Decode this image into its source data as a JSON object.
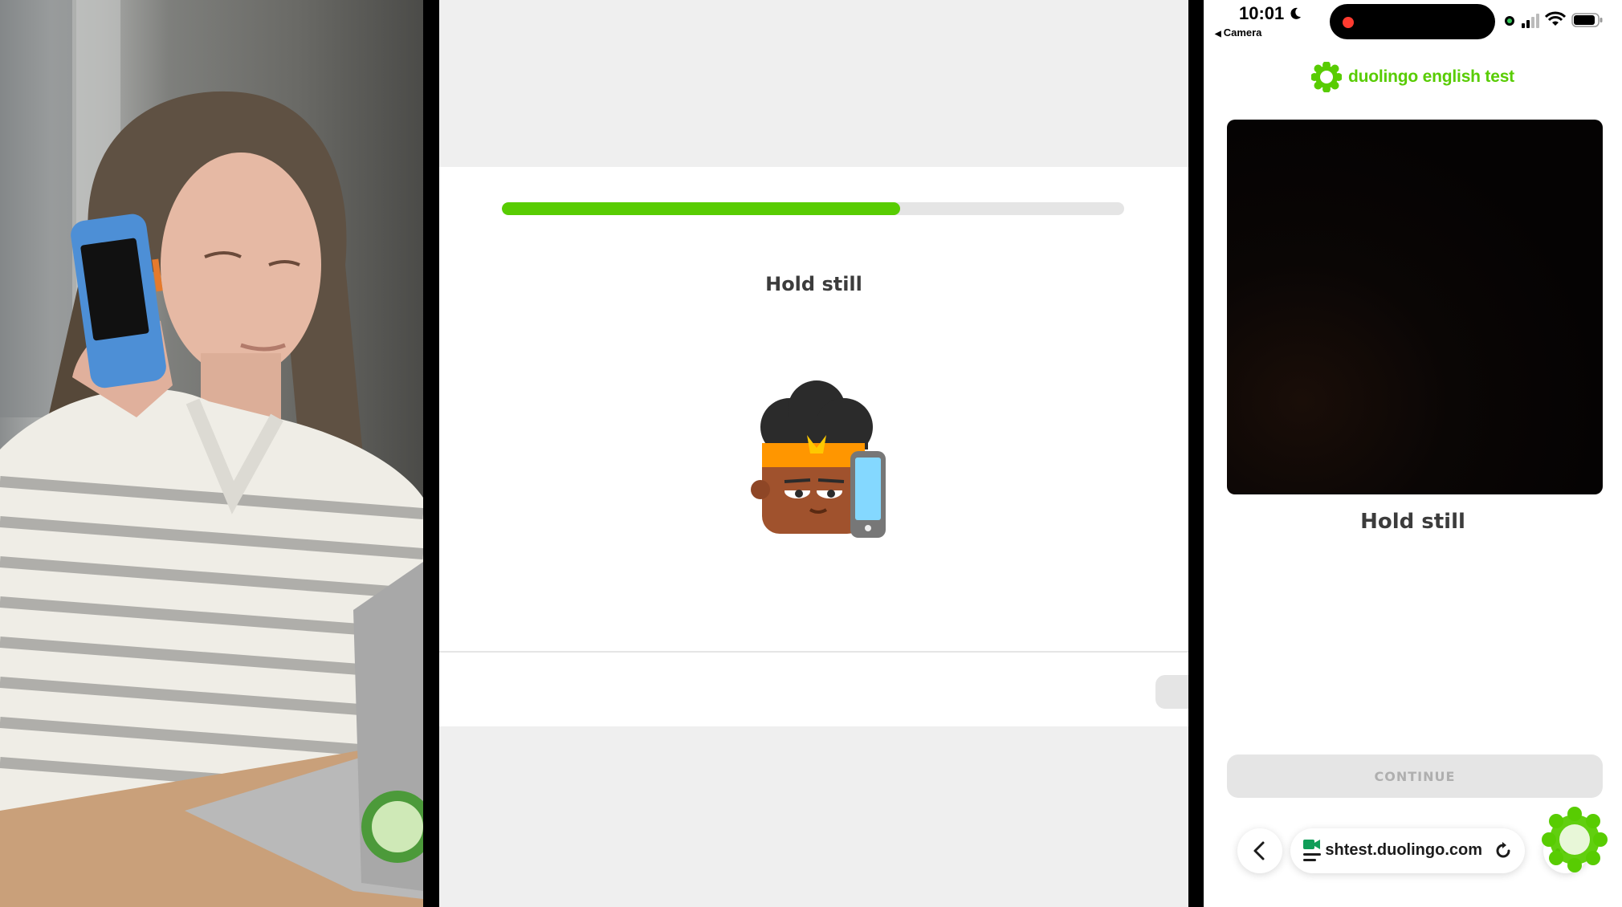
{
  "desktop": {
    "title": "Hold still",
    "progress_percent": 64
  },
  "phone": {
    "status_time": "10:01",
    "back_label": "Camera",
    "brand_name": "duolingo english test",
    "title": "Hold still",
    "continue_label": "CONTINUE",
    "address_text": "englishtest.duolingo.com"
  },
  "icons": {
    "moon": "moon-icon",
    "signal": "cellular-signal-icon",
    "wifi": "wifi-icon",
    "battery": "battery-icon",
    "logo": "duolingo-logo-icon",
    "back": "chevron-left-icon",
    "site": "video-camera-site-icon",
    "reload": "reload-icon",
    "more": "more-dots-icon"
  },
  "colors": {
    "brand_green": "#58cc02",
    "text_dark": "#3c3c3c",
    "disabled_gray": "#e5e5e5",
    "disabled_text": "#afafaf",
    "recording_red": "#ff3b30"
  }
}
